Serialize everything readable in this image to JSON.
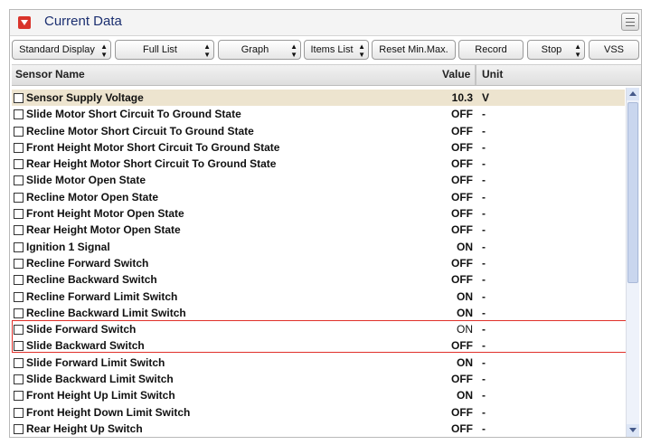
{
  "window": {
    "title": "Current Data"
  },
  "toolbar": {
    "standard_display": "Standard Display",
    "full_list": "Full List",
    "graph": "Graph",
    "items_list": "Items List",
    "reset_minmax": "Reset Min.Max.",
    "record": "Record",
    "stop": "Stop",
    "vss": "VSS"
  },
  "columns": {
    "name": "Sensor Name",
    "value": "Value",
    "unit": "Unit"
  },
  "rows": [
    {
      "name": "Sensor Supply Voltage",
      "value": "10.3",
      "unit": "V"
    },
    {
      "name": "Slide Motor Short Circuit To Ground State",
      "value": "OFF",
      "unit": "-"
    },
    {
      "name": "Recline Motor Short Circuit To Ground State",
      "value": "OFF",
      "unit": "-"
    },
    {
      "name": "Front Height Motor Short Circuit To Ground State",
      "value": "OFF",
      "unit": "-"
    },
    {
      "name": "Rear Height Motor Short Circuit To Ground State",
      "value": "OFF",
      "unit": "-"
    },
    {
      "name": "Slide Motor Open State",
      "value": "OFF",
      "unit": "-"
    },
    {
      "name": "Recline Motor Open State",
      "value": "OFF",
      "unit": "-"
    },
    {
      "name": "Front Height Motor Open State",
      "value": "OFF",
      "unit": "-"
    },
    {
      "name": "Rear Height Motor Open State",
      "value": "OFF",
      "unit": "-"
    },
    {
      "name": "Ignition 1 Signal",
      "value": "ON",
      "unit": "-"
    },
    {
      "name": "Recline Forward Switch",
      "value": "OFF",
      "unit": "-"
    },
    {
      "name": "Recline Backward Switch",
      "value": "OFF",
      "unit": "-"
    },
    {
      "name": "Recline Forward Limit Switch",
      "value": "ON",
      "unit": "-"
    },
    {
      "name": "Recline Backward Limit Switch",
      "value": "ON",
      "unit": "-"
    },
    {
      "name": "Slide Forward Switch",
      "value": "ON",
      "unit": "-"
    },
    {
      "name": "Slide Backward Switch",
      "value": "OFF",
      "unit": "-"
    },
    {
      "name": "Slide Forward Limit Switch",
      "value": "ON",
      "unit": "-"
    },
    {
      "name": "Slide Backward Limit Switch",
      "value": "OFF",
      "unit": "-"
    },
    {
      "name": "Front Height Up Limit Switch",
      "value": "ON",
      "unit": "-"
    },
    {
      "name": "Front Height Down Limit Switch",
      "value": "OFF",
      "unit": "-"
    },
    {
      "name": "Rear Height Up Switch",
      "value": "OFF",
      "unit": "-"
    }
  ],
  "colors": {
    "highlight": "#e0302a",
    "title": "#1b2f70",
    "first_row": "#ede4cf"
  }
}
